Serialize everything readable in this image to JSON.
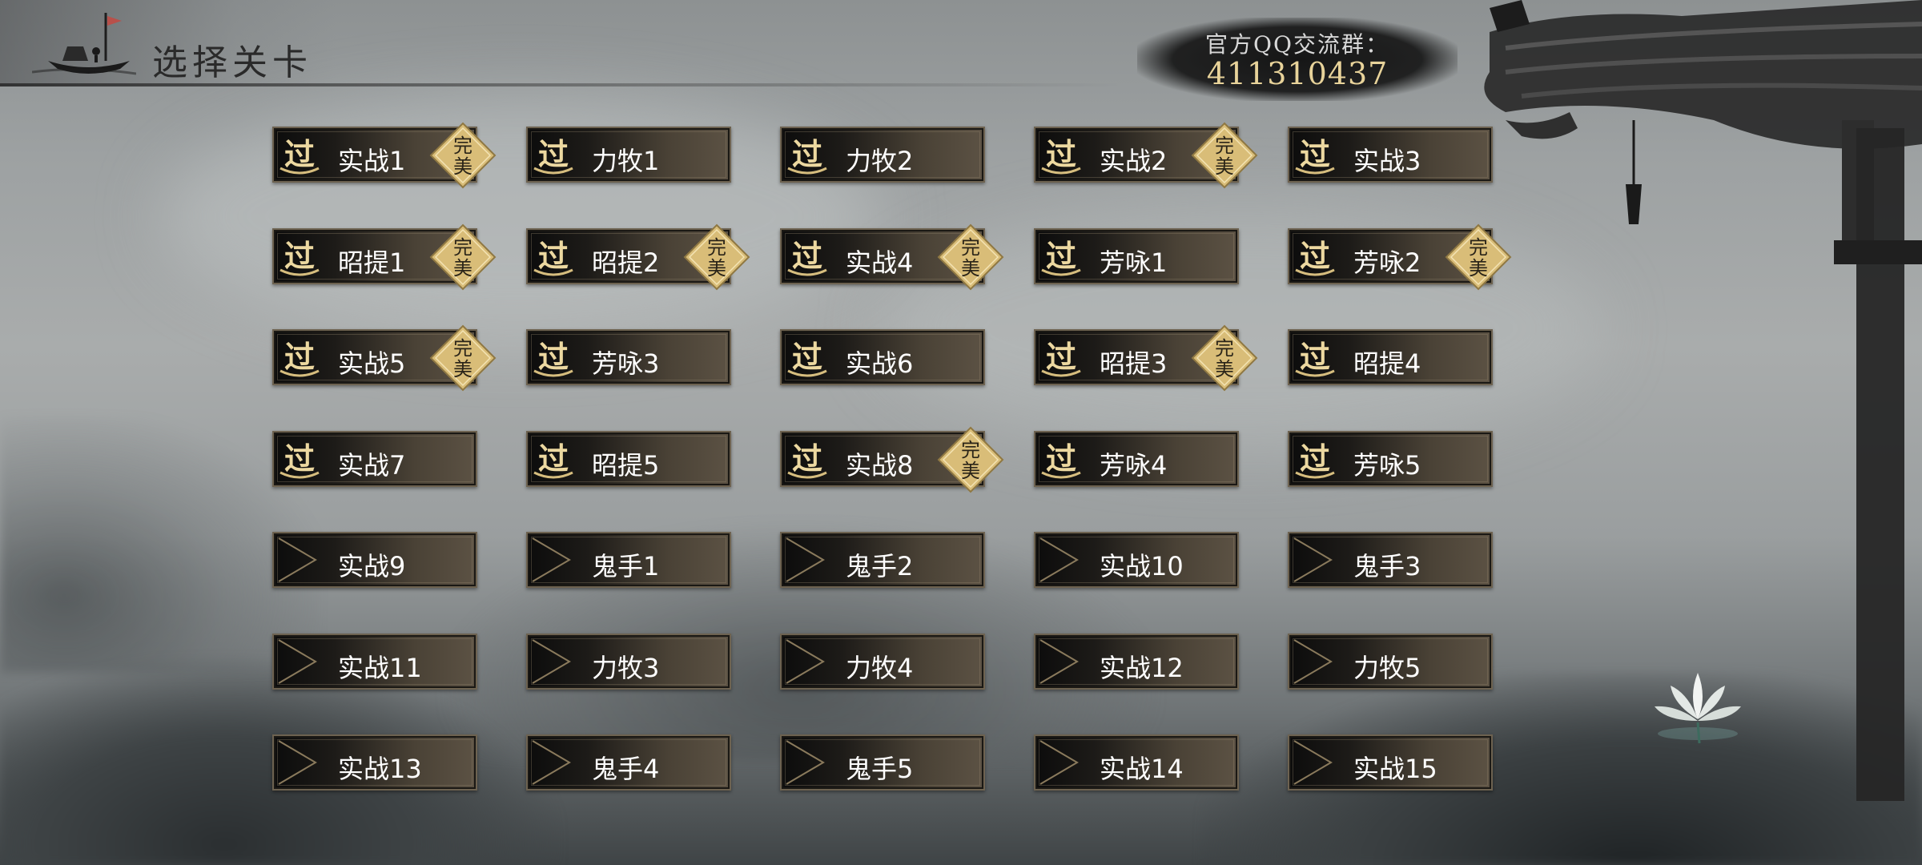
{
  "header": {
    "title": "选择关卡"
  },
  "qq": {
    "label": "官方QQ交流群：",
    "number": "411310437"
  },
  "badges": {
    "cleared_glyph": "过",
    "perfect_glyph": "完美"
  },
  "colors": {
    "gold": "#e8d39a",
    "tile_border": "#6d6250",
    "badge_gold": "#d9bd78"
  },
  "levels": [
    {
      "label": "实战1",
      "cleared": true,
      "perfect": true
    },
    {
      "label": "力牧1",
      "cleared": true,
      "perfect": false
    },
    {
      "label": "力牧2",
      "cleared": true,
      "perfect": false
    },
    {
      "label": "实战2",
      "cleared": true,
      "perfect": true
    },
    {
      "label": "实战3",
      "cleared": true,
      "perfect": false
    },
    {
      "label": "昭提1",
      "cleared": true,
      "perfect": true
    },
    {
      "label": "昭提2",
      "cleared": true,
      "perfect": true
    },
    {
      "label": "实战4",
      "cleared": true,
      "perfect": true
    },
    {
      "label": "芳咏1",
      "cleared": true,
      "perfect": false
    },
    {
      "label": "芳咏2",
      "cleared": true,
      "perfect": true
    },
    {
      "label": "实战5",
      "cleared": true,
      "perfect": true
    },
    {
      "label": "芳咏3",
      "cleared": true,
      "perfect": false
    },
    {
      "label": "实战6",
      "cleared": true,
      "perfect": false
    },
    {
      "label": "昭提3",
      "cleared": true,
      "perfect": true
    },
    {
      "label": "昭提4",
      "cleared": true,
      "perfect": false
    },
    {
      "label": "实战7",
      "cleared": true,
      "perfect": false
    },
    {
      "label": "昭提5",
      "cleared": true,
      "perfect": false
    },
    {
      "label": "实战8",
      "cleared": true,
      "perfect": true
    },
    {
      "label": "芳咏4",
      "cleared": true,
      "perfect": false
    },
    {
      "label": "芳咏5",
      "cleared": true,
      "perfect": false
    },
    {
      "label": "实战9",
      "cleared": false,
      "perfect": false
    },
    {
      "label": "鬼手1",
      "cleared": false,
      "perfect": false
    },
    {
      "label": "鬼手2",
      "cleared": false,
      "perfect": false
    },
    {
      "label": "实战10",
      "cleared": false,
      "perfect": false
    },
    {
      "label": "鬼手3",
      "cleared": false,
      "perfect": false
    },
    {
      "label": "实战11",
      "cleared": false,
      "perfect": false
    },
    {
      "label": "力牧3",
      "cleared": false,
      "perfect": false
    },
    {
      "label": "力牧4",
      "cleared": false,
      "perfect": false
    },
    {
      "label": "实战12",
      "cleared": false,
      "perfect": false
    },
    {
      "label": "力牧5",
      "cleared": false,
      "perfect": false
    },
    {
      "label": "实战13",
      "cleared": false,
      "perfect": false
    },
    {
      "label": "鬼手4",
      "cleared": false,
      "perfect": false
    },
    {
      "label": "鬼手5",
      "cleared": false,
      "perfect": false
    },
    {
      "label": "实战14",
      "cleared": false,
      "perfect": false
    },
    {
      "label": "实战15",
      "cleared": false,
      "perfect": false
    }
  ]
}
